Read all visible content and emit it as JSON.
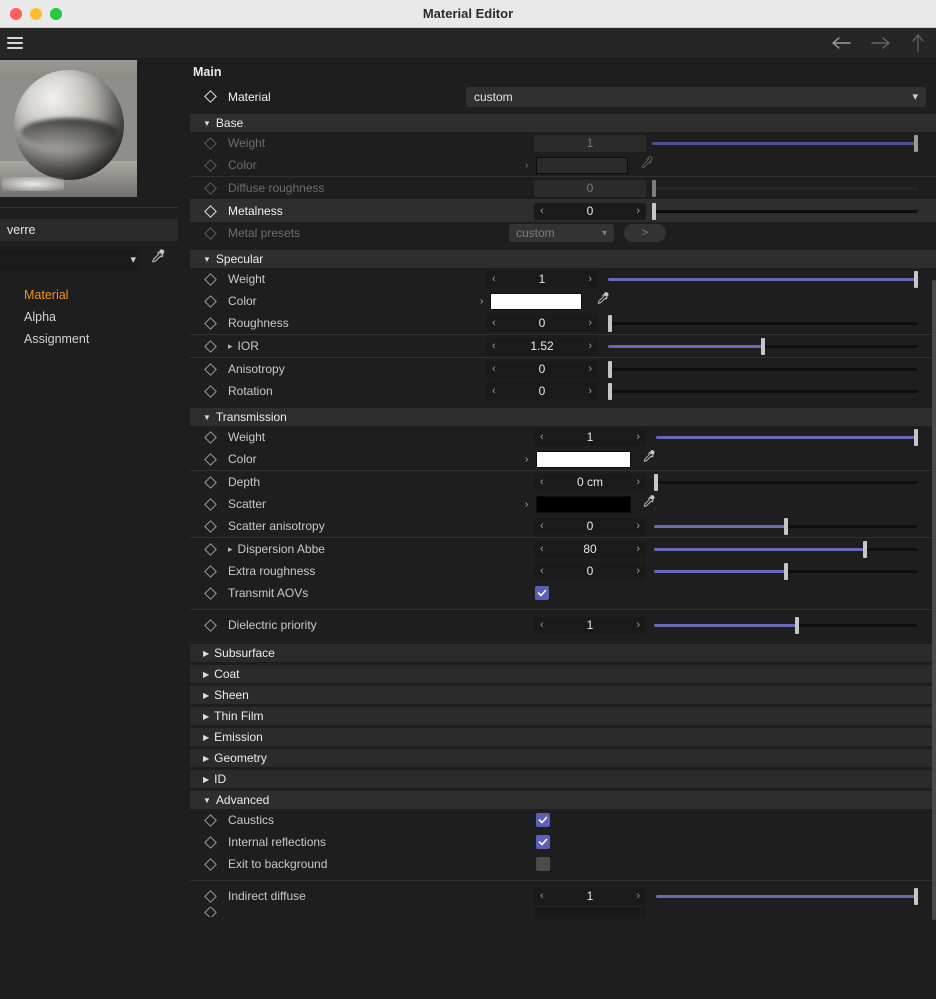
{
  "window": {
    "title": "Material Editor",
    "traffic_lights": [
      "close-button",
      "minimize-button",
      "maximize-button"
    ]
  },
  "toolbar": {
    "menu_icon": "hamburger-icon",
    "back_icon": "arrow-left-icon",
    "forward_icon": "arrow-right-icon",
    "up_icon": "arrow-up-icon"
  },
  "sidebar": {
    "preview_label": "material-preview-sphere",
    "name_value": "verre",
    "selector_value": "",
    "eyedropper_icon": "eyedropper-icon",
    "items": [
      {
        "label": "Material",
        "active": true
      },
      {
        "label": "Alpha",
        "active": false
      },
      {
        "label": "Assignment",
        "active": false
      }
    ]
  },
  "main": {
    "title": "Main",
    "material_label": "Material",
    "material_value": "custom",
    "sections": [
      {
        "name": "Base",
        "expanded": true,
        "rows": [
          {
            "label": "Weight",
            "type": "slider",
            "value": "1",
            "fill": 100,
            "handle": 100,
            "dim": true,
            "arrows": false
          },
          {
            "label": "Color",
            "type": "color",
            "swatch": "#2b2b2b",
            "dim": true
          },
          {
            "label": "Diffuse roughness",
            "type": "slider",
            "value": "0",
            "fill": 0,
            "handle": 0,
            "dim": true,
            "arrows": false
          },
          {
            "label": "Metalness",
            "type": "slider",
            "value": "0",
            "fill": 0,
            "handle": 0,
            "dim": false,
            "highlight": true,
            "arrows": true
          },
          {
            "label": "Metal presets",
            "type": "dropdown",
            "value": "custom",
            "button": ">",
            "dim": true
          }
        ]
      },
      {
        "name": "Specular",
        "expanded": true,
        "rows": [
          {
            "label": "Weight",
            "type": "slider",
            "value": "1",
            "fill": 100,
            "handle": 100,
            "arrows": true
          },
          {
            "label": "Color",
            "type": "color",
            "swatch": "#ffffff"
          },
          {
            "label": "Roughness",
            "type": "slider",
            "value": "0",
            "fill": 0,
            "handle": 0,
            "arrows": true
          },
          {
            "label": "IOR",
            "type": "slider",
            "value": "1.52",
            "fill": 50,
            "handle": 50,
            "arrows": true,
            "expandable": true
          },
          {
            "label": "Anisotropy",
            "type": "slider",
            "value": "0",
            "fill": 0,
            "handle": 0,
            "arrows": true
          },
          {
            "label": "Rotation",
            "type": "slider",
            "value": "0",
            "fill": 0,
            "handle": 0,
            "arrows": true
          }
        ]
      },
      {
        "name": "Transmission",
        "expanded": true,
        "rows": [
          {
            "label": "Weight",
            "type": "slider",
            "value": "1",
            "fill": 100,
            "handle": 100,
            "arrows": true
          },
          {
            "label": "Color",
            "type": "color",
            "swatch": "#fdfdfb"
          },
          {
            "label": "Depth",
            "type": "slider",
            "value": "0 cm",
            "fill": 0,
            "handle": 0,
            "arrows": true
          },
          {
            "label": "Scatter",
            "type": "color",
            "swatch": "#000000"
          },
          {
            "label": "Scatter anisotropy",
            "type": "slider",
            "value": "0",
            "fill": 50,
            "handle": 50,
            "arrows": true
          },
          {
            "label": "Dispersion Abbe",
            "type": "slider",
            "value": "80",
            "fill": 80,
            "handle": 80,
            "arrows": true,
            "expandable": true
          },
          {
            "label": "Extra roughness",
            "type": "slider",
            "value": "0",
            "fill": 50,
            "handle": 50,
            "arrows": true
          },
          {
            "label": "Transmit AOVs",
            "type": "checkbox",
            "checked": true
          },
          {
            "label": "Dielectric priority",
            "type": "slider",
            "value": "1",
            "fill": 54,
            "handle": 54,
            "arrows": true
          }
        ]
      },
      {
        "name": "Subsurface",
        "expanded": false,
        "rows": []
      },
      {
        "name": "Coat",
        "expanded": false,
        "rows": []
      },
      {
        "name": "Sheen",
        "expanded": false,
        "rows": []
      },
      {
        "name": "Thin Film",
        "expanded": false,
        "rows": []
      },
      {
        "name": "Emission",
        "expanded": false,
        "rows": []
      },
      {
        "name": "Geometry",
        "expanded": false,
        "rows": []
      },
      {
        "name": "ID",
        "expanded": false,
        "rows": []
      },
      {
        "name": "Advanced",
        "expanded": true,
        "rows": [
          {
            "label": "Caustics",
            "type": "checkbox",
            "checked": true
          },
          {
            "label": "Internal reflections",
            "type": "checkbox",
            "checked": true
          },
          {
            "label": "Exit to background",
            "type": "checkbox",
            "checked": false
          },
          {
            "label": "Indirect diffuse",
            "type": "slider",
            "value": "1",
            "fill": 100,
            "handle": 100,
            "arrows": true
          }
        ]
      }
    ]
  },
  "colors": {
    "accent_orange": "#f0921e",
    "slider_blue": "#6769b8",
    "checkbox_blue": "#5c5fb8",
    "panel_bg": "#1e1e1e",
    "header_bg": "#2e2e2e"
  }
}
